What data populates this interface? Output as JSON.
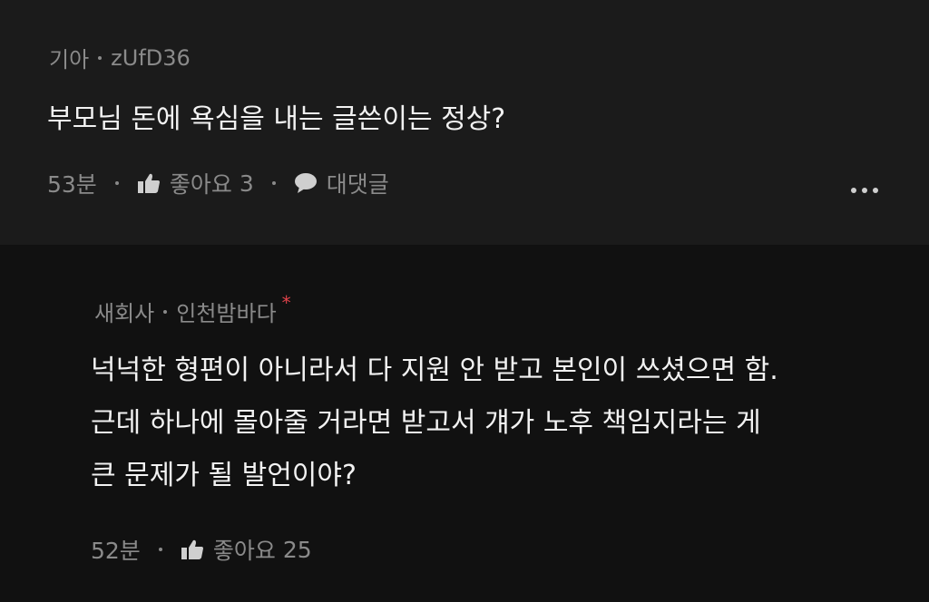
{
  "post": {
    "category": "기아",
    "author": "zUfD36",
    "title": "부모님 돈에 욕심을 내는 글쓴이는 정상?",
    "time": "53분",
    "like_label": "좋아요",
    "like_count": "3",
    "reply_label": "대댓글"
  },
  "reply": {
    "category": "새회사",
    "author": "인천밤바다",
    "author_mark": "*",
    "lines": [
      "넉넉한 형편이 아니라서 다 지원 안 받고 본인이 쓰셨으면 함.",
      "근데 하나에 몰아줄 거라면 받고서 걔가 노후 책임지라는 게",
      "큰 문제가 될 발언이야?"
    ],
    "time": "52분",
    "like_label": "좋아요",
    "like_count": "25"
  },
  "icons": {
    "like": "thumbs-up-icon",
    "comment": "speech-bubble-icon",
    "more": "more-horizontal-icon"
  }
}
